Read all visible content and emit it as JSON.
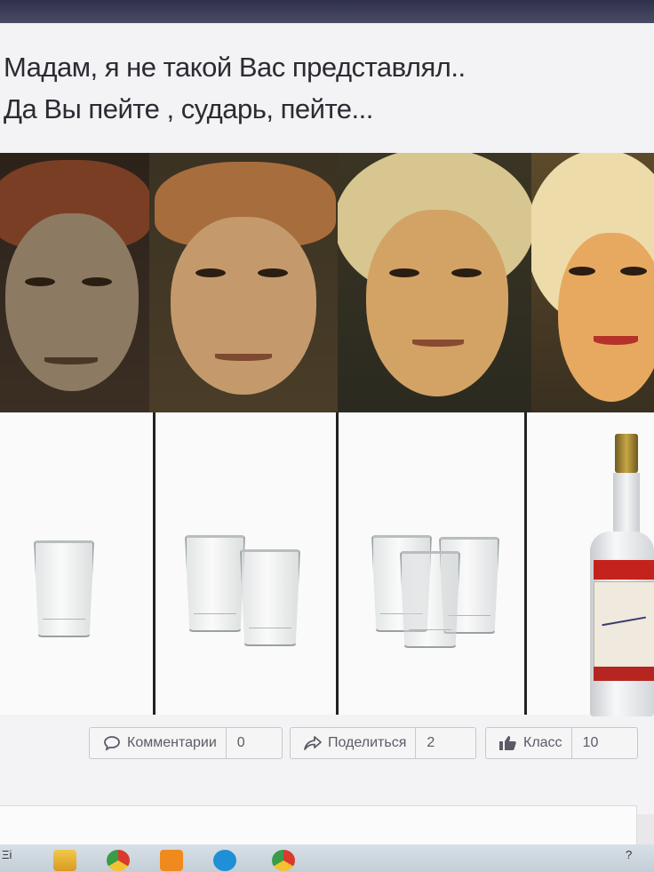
{
  "post": {
    "caption_line1": "Мадам, я не такой Вас представлял..",
    "caption_line2": "Да Вы пейте , сударь, пейте..."
  },
  "panels": [
    {
      "glass_count": 1
    },
    {
      "glass_count": 2
    },
    {
      "glass_count": 3
    },
    {
      "bottle": true
    }
  ],
  "actions": {
    "comments_label": "Комментарии",
    "comments_count": "0",
    "share_label": "Поделиться",
    "share_count": "2",
    "like_label": "Класс",
    "like_count": "10"
  },
  "taskbar": {
    "left_glyph": "Ξi",
    "right_glyph": "?"
  },
  "icons": {
    "comments": "speech-bubble-icon",
    "share": "share-arrow-icon",
    "like": "thumbs-up-icon"
  },
  "colors": {
    "caption": "#2b2b33",
    "button_text": "#5b5b66",
    "taskbar": "#c3ced7"
  }
}
